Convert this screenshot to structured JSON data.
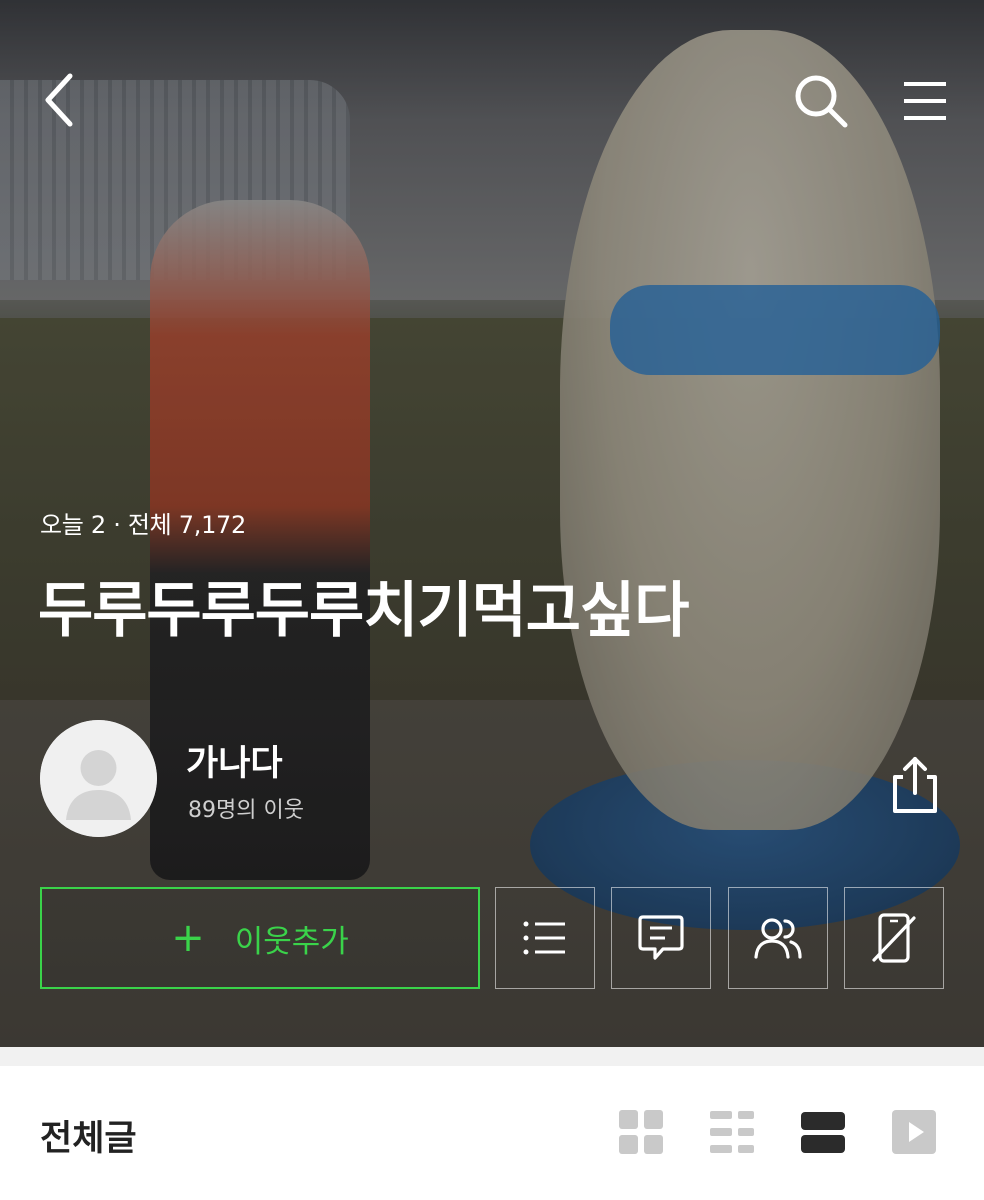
{
  "stats": {
    "today_label": "오늘 2",
    "separator": "·",
    "total_label": "전체 7,172"
  },
  "blog": {
    "title": "두루두루두루치기먹고싶다"
  },
  "profile": {
    "name": "가나다",
    "neighbors": "89명의 이웃"
  },
  "actions": {
    "add_neighbor_icon": "+",
    "add_neighbor_label": "이웃추가",
    "accent_color": "#3ad34a"
  },
  "icons": {
    "back": "chevron-left-icon",
    "search": "search-icon",
    "menu": "hamburger-icon",
    "share": "share-icon",
    "list": "list-icon",
    "chat": "chat-icon",
    "people": "people-icon",
    "phone_off": "phone-off-icon"
  },
  "posts": {
    "section_label": "전체글",
    "active_view": "card"
  }
}
